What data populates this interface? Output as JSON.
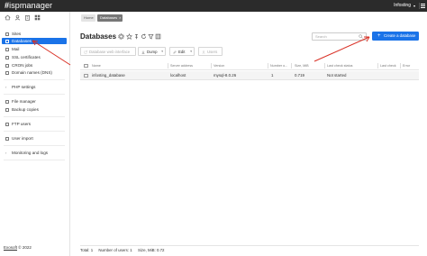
{
  "app": {
    "logo_prefix": "isp",
    "logo_suffix": "manager",
    "user": "Infosting"
  },
  "breadcrumb": {
    "home": "Home",
    "current": "Databases"
  },
  "sidebar": {
    "items": [
      {
        "label": "Sites",
        "active": false
      },
      {
        "label": "Databases",
        "active": true
      },
      {
        "label": "Mail",
        "active": false
      },
      {
        "label": "SSL certificates",
        "active": false
      },
      {
        "label": "CRON jobs",
        "active": false
      },
      {
        "label": "Domain names (DNS)",
        "active": false
      }
    ],
    "groups": [
      "PHP settings",
      "File manager",
      "Backup copies",
      "FTP users",
      "User import",
      "Monitoring and logs"
    ],
    "copyright_link": "Exosoft",
    "copyright_year": "© 2022"
  },
  "main": {
    "title": "Databases",
    "search_placeholder": "Search",
    "create_button": "Create a database",
    "toolbar": {
      "db_web_interface": "Database web interface",
      "dump": "Dump",
      "edit": "Edit",
      "users": "Users"
    },
    "table": {
      "columns": [
        "Name",
        "Server address",
        "Version",
        "Number o...",
        "Size, MiB",
        "Last check status",
        "Last check",
        "Error"
      ],
      "rows": [
        {
          "name": "infosting_database",
          "server": "localhost",
          "version": "mysql-8.0.26",
          "users": "1",
          "size": "0.719",
          "check_status": "Not started",
          "last_check": "",
          "error": ""
        }
      ]
    },
    "footer": {
      "total": "Total: 1",
      "users": "Number of users: 1",
      "size": "Size, MiB: 0.72"
    }
  },
  "colors": {
    "accent": "#1a73e8",
    "topbar": "#2b2b2b",
    "annotation": "#d93025"
  }
}
